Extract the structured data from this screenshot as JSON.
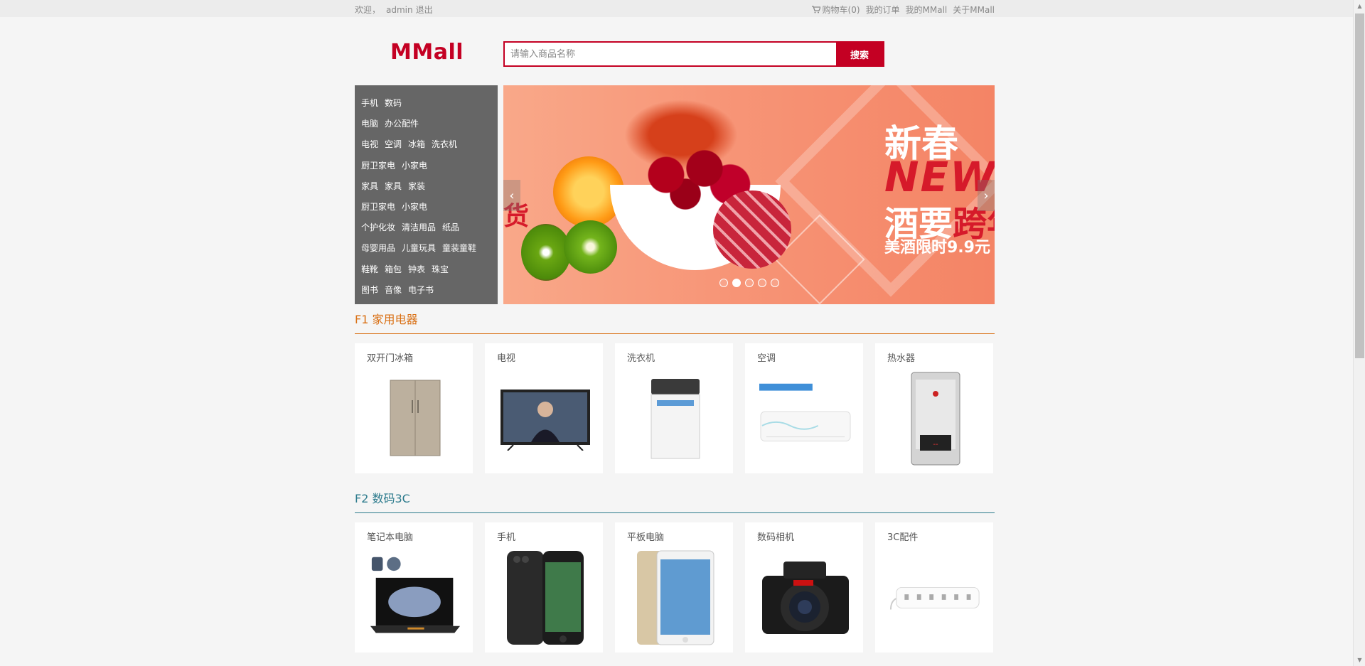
{
  "topbar": {
    "welcome": "欢迎，",
    "username": "admin",
    "logout": "退出",
    "cart": "购物车(0)",
    "orders": "我的订单",
    "my_mmall": "我的MMall",
    "about": "关于MMall"
  },
  "header": {
    "logo": "MMall",
    "search_placeholder": "请输入商品名称",
    "search_button": "搜索"
  },
  "categories": [
    [
      "手机",
      "数码"
    ],
    [
      "电脑",
      "办公配件"
    ],
    [
      "电视",
      "空调",
      "冰箱",
      "洗衣机"
    ],
    [
      "厨卫家电",
      "小家电"
    ],
    [
      "家具",
      "家具",
      "家装"
    ],
    [
      "厨卫家电",
      "小家电"
    ],
    [
      "个护化妆",
      "清洁用品",
      "纸品"
    ],
    [
      "母婴用品",
      "儿童玩具",
      "童装童鞋"
    ],
    [
      "鞋靴",
      "箱包",
      "钟表",
      "珠宝"
    ],
    [
      "图书",
      "音像",
      "电子书"
    ]
  ],
  "banner": {
    "line1": "新春",
    "line2": "NEW",
    "line3a": "酒要",
    "line3b": "跨年",
    "line4": "美酒限时9.9元",
    "left_char": "货",
    "active_dot": 1,
    "dot_count": 5
  },
  "floors": [
    {
      "title": "F1 家用电器",
      "color": "#d96f13",
      "items": [
        "双开门冰箱",
        "电视",
        "洗衣机",
        "空调",
        "热水器"
      ]
    },
    {
      "title": "F2 数码3C",
      "color": "#2b7a8c",
      "items": [
        "笔记本电脑",
        "手机",
        "平板电脑",
        "数码相机",
        "3C配件"
      ]
    }
  ],
  "colors": {
    "brand": "#c40023",
    "nav_bg": "#666666"
  }
}
